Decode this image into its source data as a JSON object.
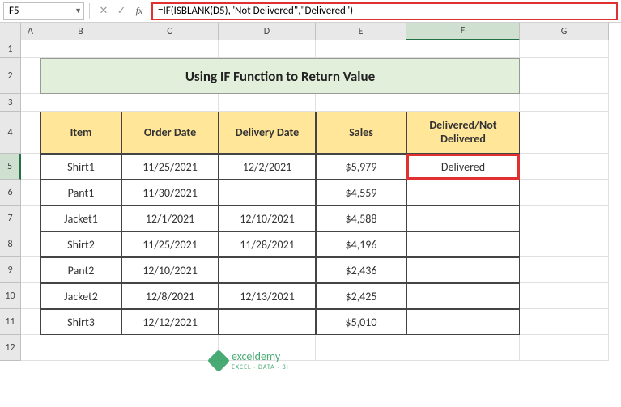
{
  "nameBox": "F5",
  "formula": "=IF(ISBLANK(D5),\"Not Delivered\",\"Delivered\")",
  "columns": [
    "A",
    "B",
    "C",
    "D",
    "E",
    "F",
    "G"
  ],
  "rowNums": [
    "1",
    "2",
    "3",
    "4",
    "5",
    "6",
    "7",
    "8",
    "9",
    "10",
    "11",
    "12"
  ],
  "activeCol": "F",
  "activeRow": "5",
  "title": "Using IF Function to Return Value",
  "headers": {
    "item": "Item",
    "orderDate": "Order Date",
    "deliveryDate": "Delivery Date",
    "sales": "Sales",
    "status": "Delivered/Not Delivered"
  },
  "rows": [
    {
      "item": "Shirt1",
      "order": "11/25/2021",
      "delivery": "12/2/2021",
      "sales": "$5,979",
      "status": "Delivered"
    },
    {
      "item": "Pant1",
      "order": "11/30/2021",
      "delivery": "",
      "sales": "$4,559",
      "status": ""
    },
    {
      "item": "Jacket1",
      "order": "12/1/2021",
      "delivery": "12/10/2021",
      "sales": "$4,588",
      "status": ""
    },
    {
      "item": "Shirt2",
      "order": "11/25/2021",
      "delivery": "11/28/2021",
      "sales": "$4,196",
      "status": ""
    },
    {
      "item": "Pant2",
      "order": "12/10/2021",
      "delivery": "",
      "sales": "$2,436",
      "status": ""
    },
    {
      "item": "Jacket2",
      "order": "12/8/2021",
      "delivery": "12/13/2021",
      "sales": "$2,425",
      "status": ""
    },
    {
      "item": "Shirt3",
      "order": "12/12/2021",
      "delivery": "",
      "sales": "$5,010",
      "status": ""
    }
  ],
  "watermark": {
    "brand": "exceldemy",
    "tag": "EXCEL · DATA · BI"
  },
  "rowHeights": {
    "r1": 22,
    "r2": 44,
    "r3": 22,
    "r4": 52,
    "rd": 32,
    "r12": 32
  },
  "chart_data": {
    "type": "table",
    "title": "Using IF Function to Return Value",
    "columns": [
      "Item",
      "Order Date",
      "Delivery Date",
      "Sales",
      "Delivered/Not Delivered"
    ],
    "data": [
      [
        "Shirt1",
        "11/25/2021",
        "12/2/2021",
        5979,
        "Delivered"
      ],
      [
        "Pant1",
        "11/30/2021",
        null,
        4559,
        null
      ],
      [
        "Jacket1",
        "12/1/2021",
        "12/10/2021",
        4588,
        null
      ],
      [
        "Shirt2",
        "11/25/2021",
        "11/28/2021",
        4196,
        null
      ],
      [
        "Pant2",
        "12/10/2021",
        null,
        2436,
        null
      ],
      [
        "Jacket2",
        "12/8/2021",
        "12/13/2021",
        2425,
        null
      ],
      [
        "Shirt3",
        "12/12/2021",
        null,
        5010,
        null
      ]
    ]
  }
}
